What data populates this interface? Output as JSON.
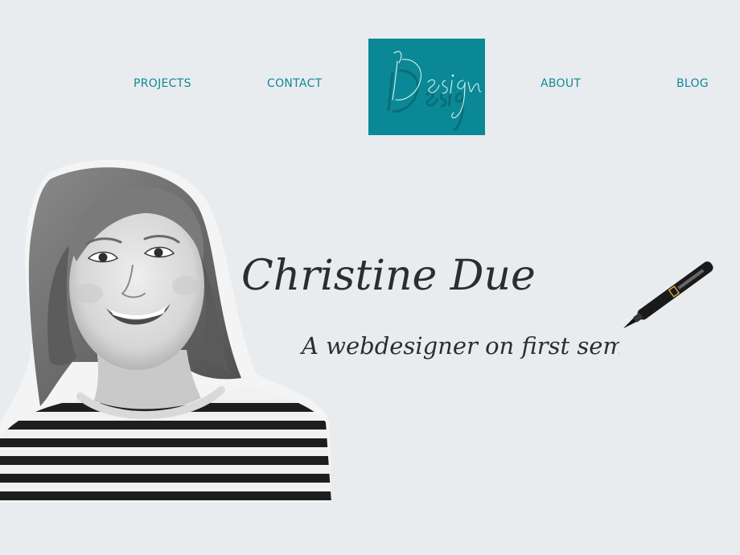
{
  "nav": {
    "projects": "PROJECTS",
    "contact": "CONTACT",
    "about": "ABOUT",
    "blog": "BLOG"
  },
  "logo": {
    "text": "IDesign"
  },
  "hero": {
    "name": "Christine Due",
    "tagline": "A webdesigner on first semester"
  },
  "colors": {
    "background": "#e9ecef",
    "accent": "#0b8895",
    "nav_text": "#0d8a96",
    "script_ink": "#2d2d2d"
  },
  "icons": {
    "pen": "pen-icon",
    "portrait": "portrait-photo"
  }
}
